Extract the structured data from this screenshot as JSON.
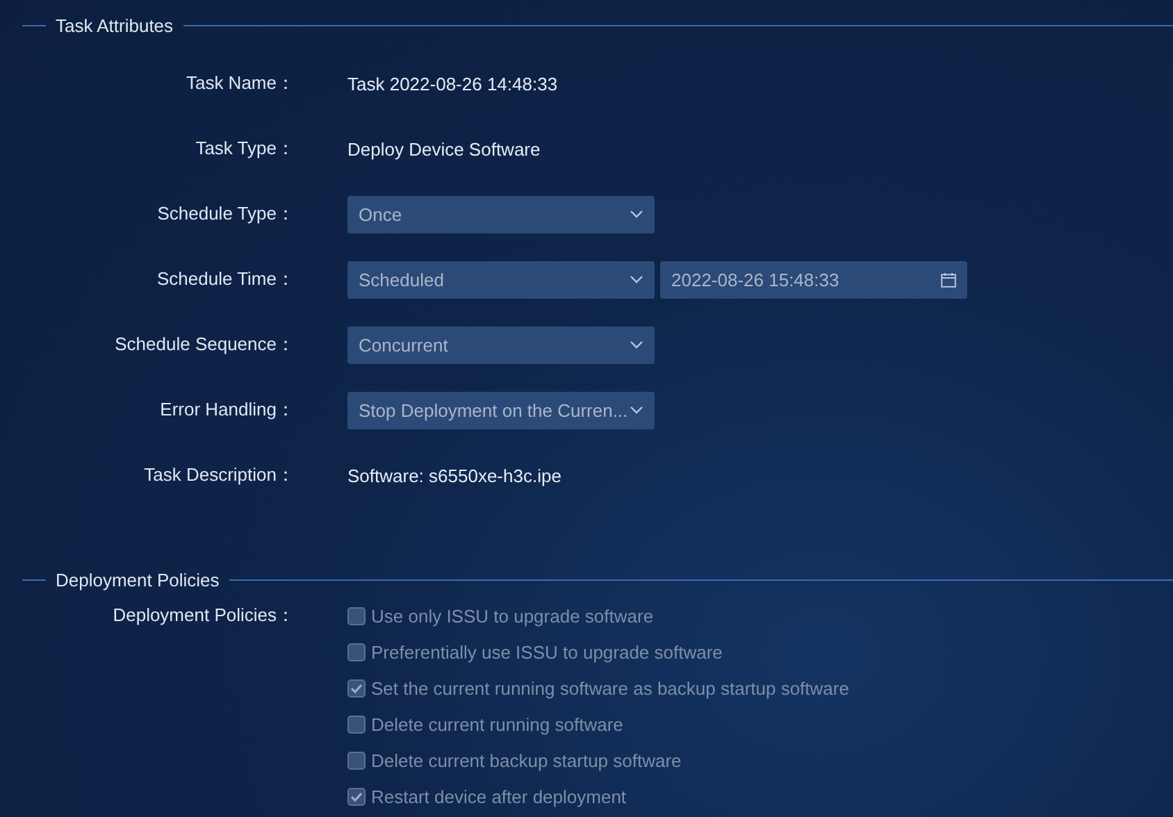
{
  "sections": [
    {
      "title": "Task Attributes",
      "fields": [
        {
          "kind": "text",
          "label": "Task Name：",
          "value": "Task 2022-08-26 14:48:33"
        },
        {
          "kind": "text",
          "label": "Task Type：",
          "value": "Deploy Device Software"
        },
        {
          "kind": "select",
          "label": "Schedule Type：",
          "value": "Once"
        },
        {
          "kind": "select_date",
          "label": "Schedule Time：",
          "value": "Scheduled",
          "date": "2022-08-26 15:48:33"
        },
        {
          "kind": "select",
          "label": "Schedule Sequence：",
          "value": "Concurrent"
        },
        {
          "kind": "select",
          "label": "Error Handling：",
          "value": "Stop Deployment on the Curren..."
        },
        {
          "kind": "text",
          "label": "Task Description：",
          "value": "Software: s6550xe-h3c.ipe"
        }
      ]
    },
    {
      "title": "Deployment Policies",
      "fields": [
        {
          "kind": "checkboxes",
          "label": "Deployment Policies：",
          "options": [
            {
              "label": "Use only ISSU to upgrade software",
              "checked": false,
              "disabled": true
            },
            {
              "label": "Preferentially use ISSU to upgrade software",
              "checked": false,
              "disabled": true
            },
            {
              "label": "Set the current running software as backup startup software",
              "checked": true,
              "disabled": true
            },
            {
              "label": "Delete current running software",
              "checked": false,
              "disabled": true
            },
            {
              "label": "Delete current backup startup software",
              "checked": false,
              "disabled": true
            },
            {
              "label": "Restart device after deployment",
              "checked": true,
              "disabled": true
            }
          ]
        }
      ]
    }
  ]
}
